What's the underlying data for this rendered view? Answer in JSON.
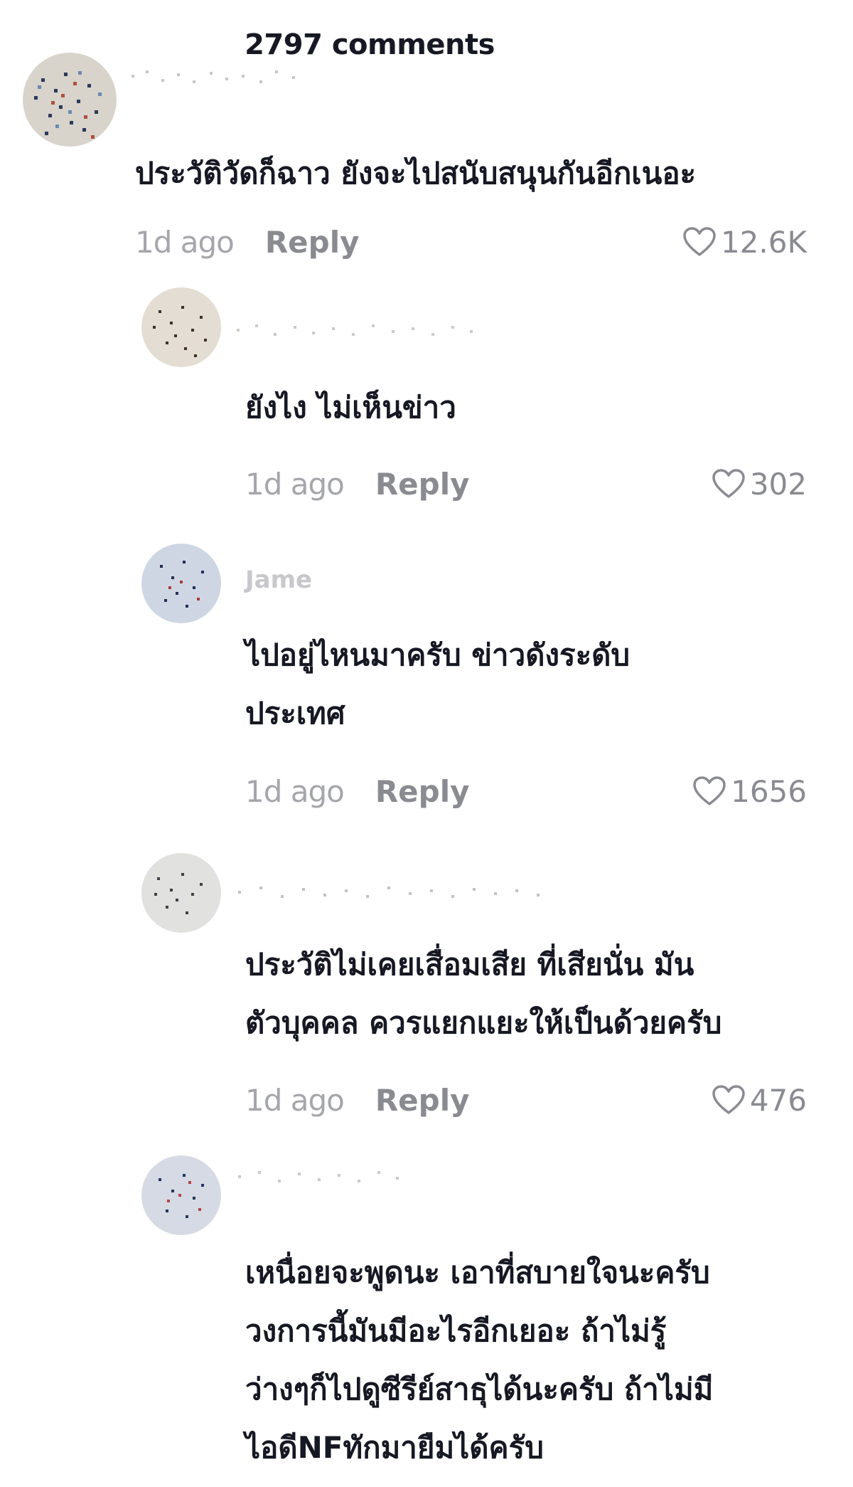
{
  "header": {
    "title": "2797 comments"
  },
  "comments": [
    {
      "username": "",
      "text": "ประวัติวัดก็ฉาว ยังจะไปสนับสนุนกันอีกเนอะ",
      "time": "1d ago",
      "reply_label": "Reply",
      "likes": "12.6K"
    },
    {
      "username": "",
      "text": "ยังไง ไม่เห็นข่าว",
      "time": "1d ago",
      "reply_label": "Reply",
      "likes": "302"
    },
    {
      "username": "Jame",
      "text": "ไปอยู่ไหนมาครับ ข่าวดังระดับ\nประเทศ",
      "time": "1d ago",
      "reply_label": "Reply",
      "likes": "1656"
    },
    {
      "username": "",
      "text": "ประวัติไม่เคยเสื่อมเสีย ที่เสียนั่น มัน\nตัวบุคคล ควรแยกแยะให้เป็นด้วยครับ",
      "time": "1d ago",
      "reply_label": "Reply",
      "likes": "476"
    },
    {
      "username": "",
      "text": "เหนื่อยจะพูดนะ เอาที่สบายใจนะครับ\nวงการนี้มันมีอะไรอีกเยอะ ถ้าไม่รู้\nว่างๆก็ไปดูซีรีย์สาธุได้นะครับ ถ้าไม่มี\nไอดีNFทักมายืมได้ครับ"
    }
  ],
  "icons": {
    "like": "heart-outline-icon"
  },
  "colors": {
    "text_primary": "#161823",
    "text_secondary": "#8a8b91",
    "time_text": "#a5a6ab"
  }
}
